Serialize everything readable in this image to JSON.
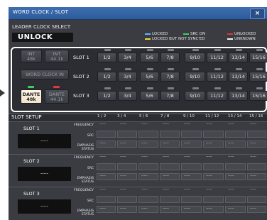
{
  "window": {
    "title": "WORD CLOCK / SLOT",
    "close_label": "×"
  },
  "leader": {
    "label": "LEADER CLOCK SELECT",
    "value": "UNLOCK"
  },
  "legend": [
    {
      "text": "LOCKED",
      "color": "#5fb8ff"
    },
    {
      "text": "SRC ON",
      "color": "#3ecf5a"
    },
    {
      "text": "UNLOCKED",
      "color": "#e0393a"
    },
    {
      "text": "LOCKED BUT NOT SYNC'ED",
      "color": "#f2d43b"
    },
    {
      "text": "UNKNOWN",
      "color": "#f2f2f2"
    }
  ],
  "clock_sources": {
    "int48": "INT\n48k",
    "int441": "INT\n44.1k",
    "wordclock": "WORD CLOCK IN",
    "dante48": "DANTE\n48k",
    "dante441": "DANTE\n44.1k"
  },
  "slots": [
    {
      "label": "SLOT 1"
    },
    {
      "label": "SLOT 2"
    },
    {
      "label": "SLOT 3"
    }
  ],
  "channel_pairs": [
    "1/2",
    "3/4",
    "5/6",
    "7/8",
    "9/10",
    "11/12",
    "13/14",
    "15/16"
  ],
  "setup": {
    "title": "SLOT SETUP",
    "columns": [
      "1 / 2",
      "3 / 4",
      "5 / 6",
      "7 / 8",
      "9 / 10",
      "11 / 12",
      "13 / 14",
      "15 / 16"
    ],
    "row_labels": {
      "frequency": "FREQUENCY",
      "src": "SRC",
      "emphasis": "EMPHASIS\nSTATUS"
    },
    "placeholder": "-----",
    "slots": [
      {
        "name": "SLOT 1",
        "display": "-----"
      },
      {
        "name": "SLOT 2",
        "display": "-----"
      },
      {
        "name": "SLOT 3",
        "display": "-----"
      }
    ]
  }
}
